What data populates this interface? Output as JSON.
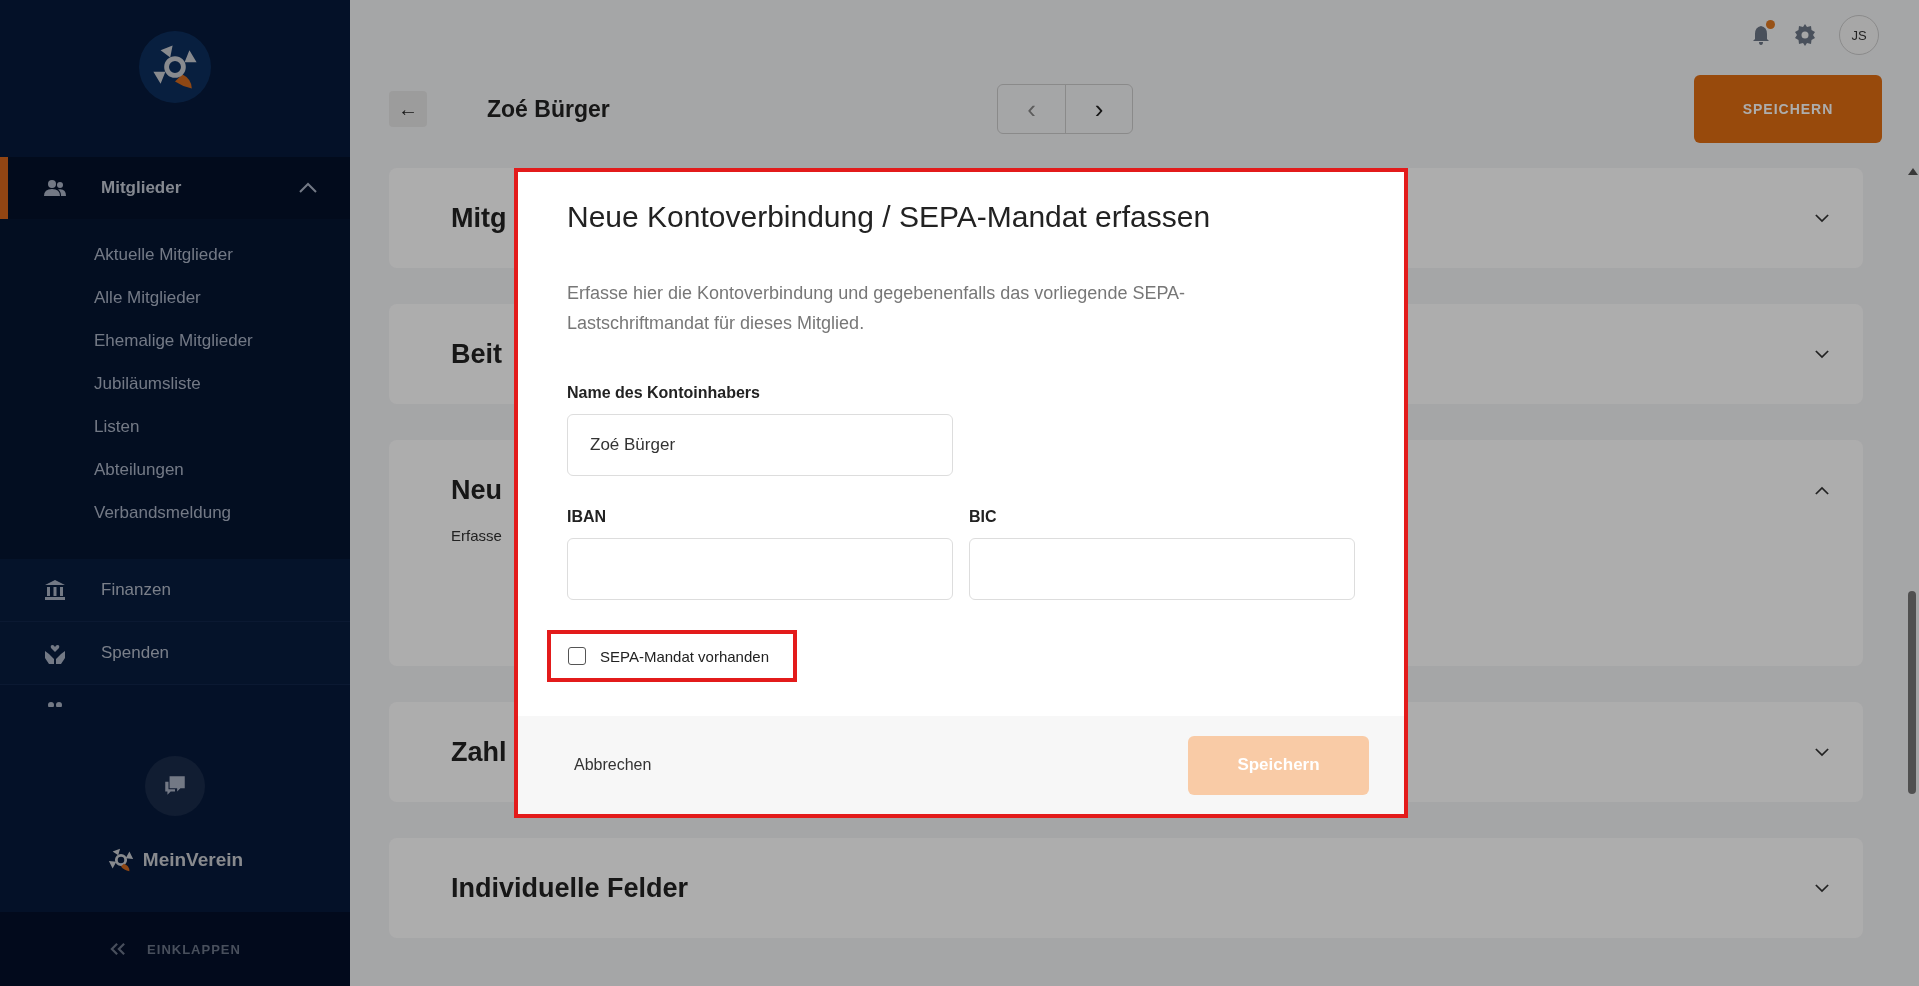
{
  "sidebar": {
    "sections": [
      {
        "label": "Mitglieder",
        "expanded": true,
        "selected": true,
        "children": [
          {
            "label": "Aktuelle Mitglieder"
          },
          {
            "label": "Alle Mitglieder"
          },
          {
            "label": "Ehemalige Mitglieder"
          },
          {
            "label": "Jubiläumsliste"
          },
          {
            "label": "Listen"
          },
          {
            "label": "Abteilungen"
          },
          {
            "label": "Verbandsmeldung"
          }
        ]
      },
      {
        "label": "Finanzen",
        "selected": false
      },
      {
        "label": "Spenden",
        "selected": false
      }
    ],
    "brand": "MeinVerein",
    "collapse": "EINKLAPPEN"
  },
  "header": {
    "avatar": "JS",
    "notification": true,
    "back": "←",
    "title": "Zoé Bürger",
    "prev": "‹",
    "next": "›",
    "save": "SPEICHERN"
  },
  "sections": [
    {
      "title": "Mitg",
      "expanded": false
    },
    {
      "title": "Beit",
      "expanded": false
    },
    {
      "title": "Neu",
      "expanded": true,
      "text": "Erfasse"
    },
    {
      "title": "Zahl",
      "expanded": false
    },
    {
      "title": "Individuelle Felder",
      "expanded": false
    }
  ],
  "dialog": {
    "title": "Neue Kontoverbindung / SEPA-Mandat erfassen",
    "description": "Erfasse hier die Kontoverbindung und gegebenenfalls das vorliegende SEPA-Lastschriftmandat für dieses Mitglied.",
    "fields": [
      {
        "label": "Name des Kontoinhabers",
        "value": "Zoé Bürger"
      },
      {
        "label": "IBAN"
      },
      {
        "label": "BIC"
      }
    ],
    "checkbox": {
      "label": "SEPA-Mandat vorhanden",
      "checked": false,
      "highlighted": true
    },
    "cancel": "Abbrechen",
    "submit": {
      "label": "Speichern",
      "disabled": true
    }
  }
}
